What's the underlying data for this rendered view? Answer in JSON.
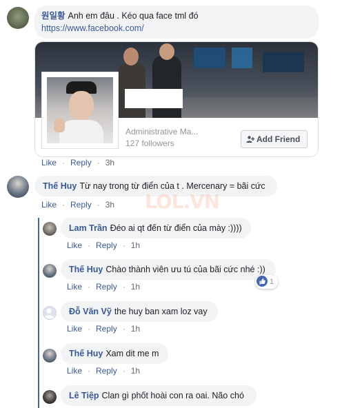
{
  "colors": {
    "link": "#385898",
    "bubble_bg": "#f2f3f5",
    "meta_text": "#606770",
    "thread_line": "#4267b2"
  },
  "comments": [
    {
      "author": "원일황",
      "text": "Anh em đâu . Kéo qua face tml đó",
      "link": "https://www.facebook.com/",
      "actions": {
        "like": "Like",
        "reply": "Reply",
        "time": "3h"
      }
    },
    {
      "author": "Thế Huy",
      "text": "Từ nay trong từ điển của t . Mercenary = bãi cức",
      "actions": {
        "like": "Like",
        "reply": "Reply",
        "time": "3h"
      }
    }
  ],
  "link_preview": {
    "page_name": "Administrative Ma...",
    "followers": "127 followers",
    "add_friend_label": "Add Friend"
  },
  "replies": [
    {
      "author": "Lam Trần",
      "text": "Đéo ai qt đến từ điển của mày :))))",
      "actions": {
        "like": "Like",
        "reply": "Reply",
        "time": "1h"
      }
    },
    {
      "author": "Thế Huy",
      "text": "Chào thành viên ưu tú của bãi cức nhé :))",
      "actions": {
        "like": "Like",
        "reply": "Reply",
        "time": "1h"
      },
      "reaction_count": "1"
    },
    {
      "author": "Đỗ Văn Vỹ",
      "text": "the huy ban xam loz vay",
      "actions": {
        "like": "Like",
        "reply": "Reply",
        "time": "1h"
      }
    },
    {
      "author": "Thế Huy",
      "text": "Xam dit me m",
      "actions": {
        "like": "Like",
        "reply": "Reply",
        "time": "1h"
      }
    },
    {
      "author": "Lê Tiệp",
      "text": "Clan gì phốt hoài con ra oai. Não chó"
    }
  ],
  "watermark": "LOL.VN",
  "icons": {
    "add_friend": "add-friend-icon",
    "like_reaction": "thumbs-up-icon"
  }
}
